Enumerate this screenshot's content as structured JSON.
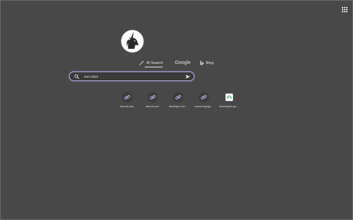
{
  "colors": {
    "background": "#484848",
    "search_border": "#bcb0f0",
    "text": "#e4e4e4",
    "link_icon": "#c4b4f4"
  },
  "engines": [
    {
      "label": "AI Search",
      "icon": "wand-icon",
      "active": true
    },
    {
      "label": "Google",
      "icon": "",
      "active": false
    },
    {
      "label": "Bing",
      "icon": "bing-icon",
      "active": false
    }
  ],
  "search": {
    "value": "euro 2024",
    "icon": "search-icon",
    "submit_icon": "send-icon"
  },
  "shortcuts": [
    {
      "label": "discord.com",
      "icon": "link-icon"
    },
    {
      "label": "discord.com",
      "icon": "link-icon"
    },
    {
      "label": "developer.chr...",
      "icon": "link-icon"
    },
    {
      "label": "chrome.googl...",
      "icon": "link-icon"
    },
    {
      "label": "developers.go...",
      "icon": "favicon-icon"
    }
  ],
  "top_right": {
    "icon": "apps-grid-icon"
  }
}
